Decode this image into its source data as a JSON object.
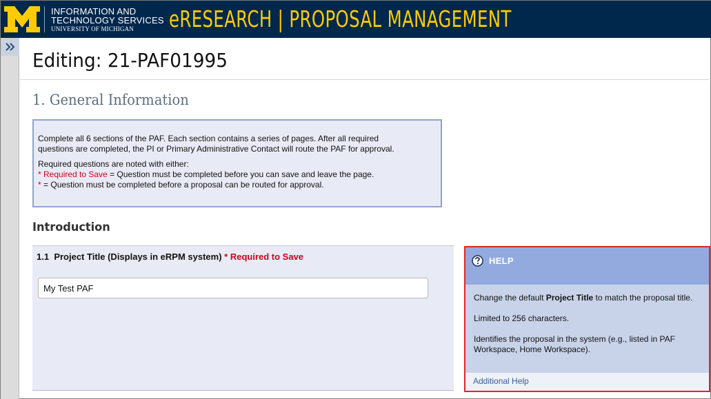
{
  "header": {
    "logo_letter": "M",
    "its_line1": "INFORMATION AND",
    "its_line2": "TECHNOLOGY SERVICES",
    "its_line3": "UNIVERSITY OF MICHIGAN",
    "app_title": "eRESEARCH  |  PROPOSAL MANAGEMENT"
  },
  "sidebar": {
    "expand_icon": "double-chevron-right-icon"
  },
  "page": {
    "title": "Editing: 21-PAF01995",
    "section_heading": "1. General Information"
  },
  "instructions": {
    "line1": "Complete all 6 sections of the PAF.  Each section contains a series of pages. After all required",
    "line2": "questions are completed, the PI or Primary Administrative Contact will route the PAF for approval.",
    "line3": "Required questions are noted with either:",
    "req_save_marker": "* Required to Save",
    "req_save_text": " = Question must be completed before you can save and leave the page.",
    "req_route_marker": "* ",
    "req_route_text": " = Question must be completed before a proposal can be routed for approval."
  },
  "intro": {
    "heading": "Introduction"
  },
  "question": {
    "number": "1.1",
    "label": "Project Title (Displays in eRPM system)",
    "required_marker": "* Required to Save",
    "value": "My Test PAF"
  },
  "help": {
    "icon": "question-circle-icon",
    "title": "HELP",
    "para1_prefix": "Change the default ",
    "para1_bold": "Project Title",
    "para1_suffix": " to match the proposal title.",
    "para2": "Limited to 256 characters.",
    "para3": "Identifies the proposal in the system (e.g., listed in PAF Workspace, Home Workspace).",
    "link": "Additional Help"
  },
  "colors": {
    "header_bg": "#00274c",
    "maize": "#ffcb05",
    "required_red": "#d0021b",
    "help_border": "#e5202e",
    "help_header": "#92aade"
  }
}
